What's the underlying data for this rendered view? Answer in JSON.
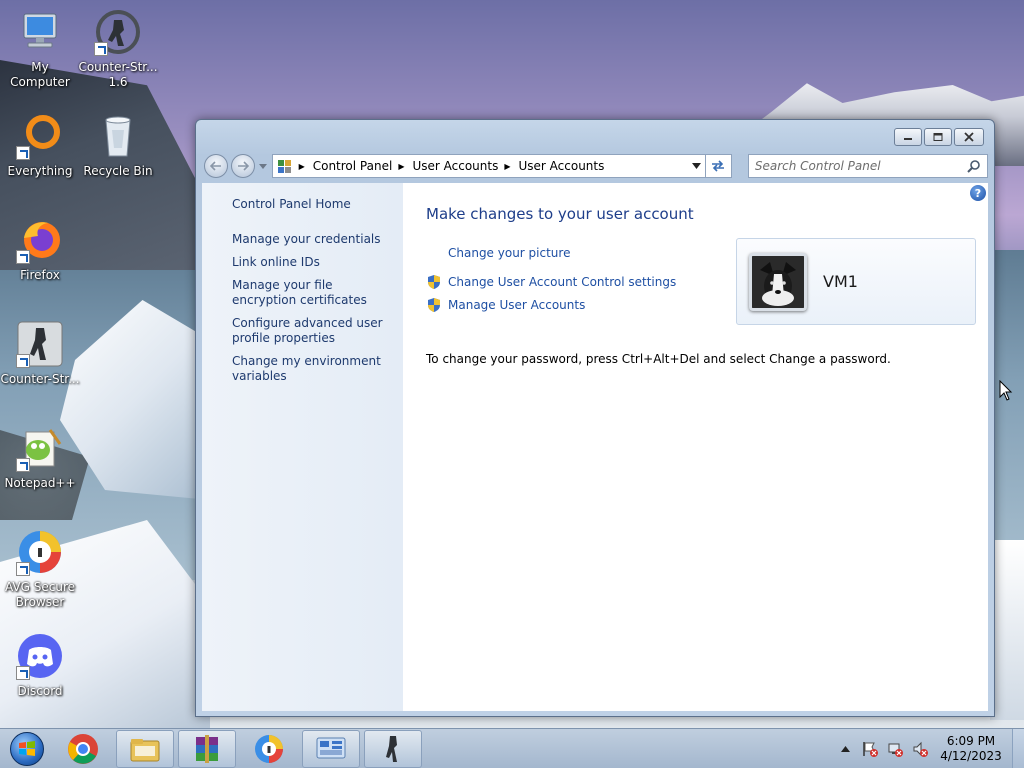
{
  "desktop": {
    "icons": [
      {
        "label": "My Computer",
        "icon": "computer-icon"
      },
      {
        "label": "Counter-Str... 1.6",
        "icon": "counter-strike-icon"
      },
      {
        "label": "Everything",
        "icon": "everything-icon"
      },
      {
        "label": "Recycle Bin",
        "icon": "recycle-bin-icon"
      },
      {
        "label": "Firefox",
        "icon": "firefox-icon"
      },
      {
        "label": "Counter-Str...",
        "icon": "counter-strike-icon"
      },
      {
        "label": "Notepad++",
        "icon": "notepad-plus-plus-icon"
      },
      {
        "label": "AVG Secure Browser",
        "icon": "avg-browser-icon"
      },
      {
        "label": "Discord",
        "icon": "discord-icon"
      }
    ]
  },
  "window": {
    "breadcrumb": [
      "Control Panel",
      "User Accounts",
      "User Accounts"
    ],
    "search_placeholder": "Search Control Panel",
    "sidebar": {
      "home": "Control Panel Home",
      "items": [
        "Manage your credentials",
        "Link online IDs",
        "Manage your file encryption certificates",
        "Configure advanced user profile properties",
        "Change my environment variables"
      ]
    },
    "main": {
      "title": "Make changes to your user account",
      "tasks": [
        {
          "label": "Change your picture",
          "shield": false
        },
        {
          "label": "Change User Account Control settings",
          "shield": true
        },
        {
          "label": "Manage User Accounts",
          "shield": true
        }
      ],
      "password_note": "To change your password, press Ctrl+Alt+Del and select Change a password.",
      "help_label": "?"
    },
    "user": {
      "name": "VM1"
    }
  },
  "taskbar": {
    "items": [
      {
        "icon": "chrome-icon",
        "pinned": false
      },
      {
        "icon": "windows-explorer-icon",
        "pinned": true
      },
      {
        "icon": "winrar-icon",
        "pinned": true
      },
      {
        "icon": "avg-browser-icon",
        "pinned": false
      },
      {
        "icon": "control-panel-icon",
        "pinned": true
      },
      {
        "icon": "counter-strike-icon",
        "pinned": true
      }
    ],
    "clock": {
      "time": "6:09 PM",
      "date": "4/12/2023"
    }
  },
  "colors": {
    "link": "#1e4fa3",
    "title": "#1e3e8a",
    "sidebar_link": "#1e3a6e",
    "accent": "#2b6bc2"
  }
}
